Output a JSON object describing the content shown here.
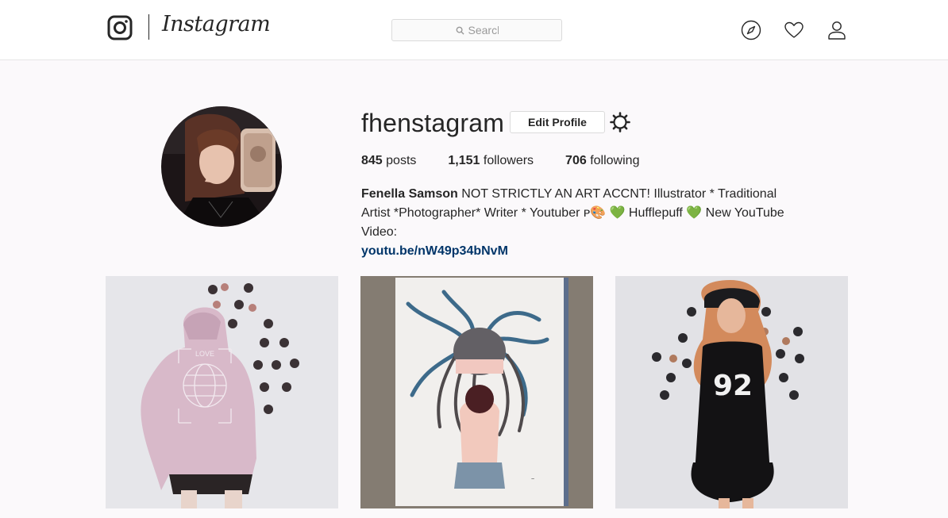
{
  "header": {
    "brand": "Instagram",
    "search_placeholder": "Search",
    "icons": [
      "instagram-glyph-icon",
      "compass-icon",
      "heart-icon",
      "person-icon",
      "search-icon"
    ]
  },
  "profile": {
    "username": "fhenstagram",
    "edit_label": "Edit Profile",
    "stats": {
      "posts_count": "845",
      "posts_label": "posts",
      "followers_count": "1,151",
      "followers_label": "followers",
      "following_count": "706",
      "following_label": "following"
    },
    "bio": {
      "full_name": "Fenella Samson",
      "text": "NOT STRICTLY AN ART ACCNT! Illustrator * Traditional Artist *Photographer* Writer * Youtuber ᴘ🎨 💚 Hufflepuff 💚 New YouTube Video:",
      "link": "youtu.be/nW49p34bNvM"
    }
  },
  "posts": [
    {
      "subject": "person in lavender hoodie with globe print",
      "hoodie_text": "LOVE"
    },
    {
      "subject": "watercolor illustration of girl with tentacle hair"
    },
    {
      "subject": "person in black 92 jersey dress"
    }
  ],
  "colors": {
    "background": "#fbf9fb",
    "header_bg": "#ffffff",
    "link": "#003569",
    "border": "#dbdbdb"
  }
}
